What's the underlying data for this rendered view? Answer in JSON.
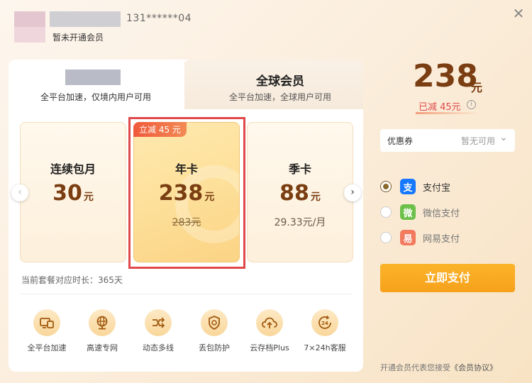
{
  "header": {
    "phone": "131******04",
    "member_status": "暂未开通会员"
  },
  "tabs": {
    "domestic_subtitle": "全平台加速，仅境内用户可用",
    "global_title": "全球会员",
    "global_subtitle": "全平台加速，全球用户可用"
  },
  "plans": [
    {
      "name": "连续包月",
      "price": "30",
      "unit": "元",
      "extra": ""
    },
    {
      "name": "年卡",
      "price": "238",
      "unit": "元",
      "extra": "283元",
      "tag": "立减 45 元"
    },
    {
      "name": "季卡",
      "price": "88",
      "unit": "元",
      "extra": "29.33元/月"
    }
  ],
  "duration_text": "当前套餐对应时长：365天",
  "features": [
    {
      "label": "全平台加速",
      "icon": "devices-icon"
    },
    {
      "label": "高速专网",
      "icon": "globe-network-icon"
    },
    {
      "label": "动态多线",
      "icon": "multi-route-icon"
    },
    {
      "label": "丢包防护",
      "icon": "shield-icon"
    },
    {
      "label": "云存档Plus",
      "icon": "cloud-upload-icon"
    },
    {
      "label": "7×24h客服",
      "icon": "24h-service-icon"
    }
  ],
  "checkout": {
    "price": "238",
    "unit": "元",
    "saved": "已减 45元",
    "coupon_label": "优惠券",
    "coupon_value": "暂无可用",
    "payment_methods": [
      {
        "label": "支付宝",
        "selected": true,
        "color": "#1677ff",
        "glyph": "支"
      },
      {
        "label": "微信支付",
        "selected": false,
        "color": "#6cc04a",
        "glyph": "微"
      },
      {
        "label": "网易支付",
        "selected": false,
        "color": "#f27a5e",
        "glyph": "易"
      }
    ],
    "pay_button": "立即支付",
    "agreement_prefix": "开通会员代表您接受",
    "agreement_link": "《会员协议》"
  },
  "colors": {
    "accent_brown": "#7a3e12",
    "pay_orange": "#f6a11b",
    "highlight_red": "#e0494a"
  }
}
